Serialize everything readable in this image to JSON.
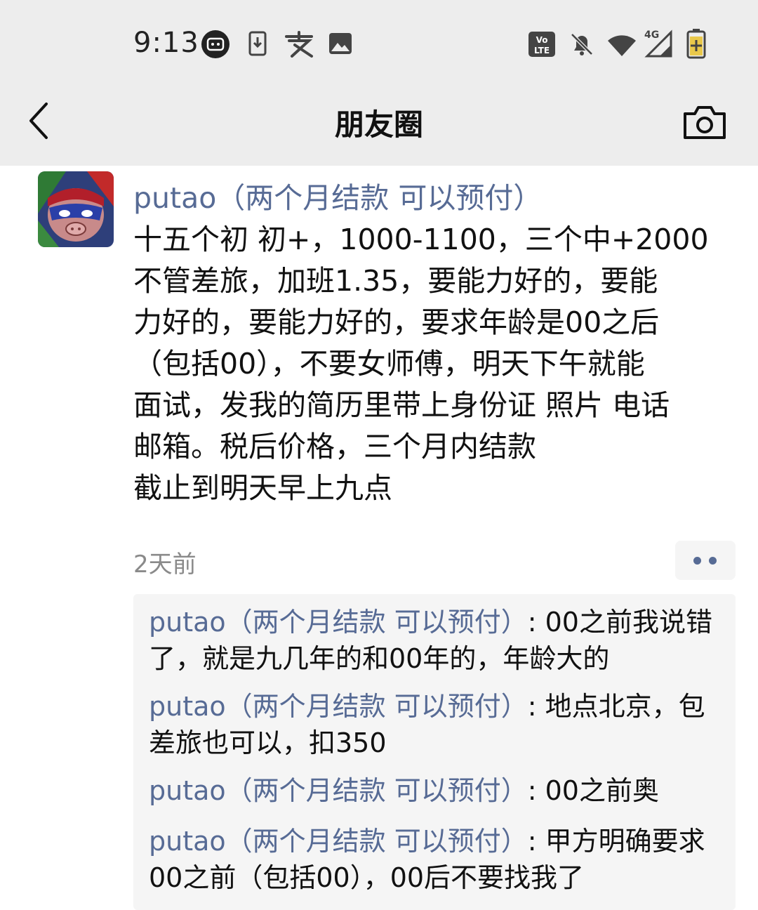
{
  "status_bar": {
    "time": "9:13",
    "left_icons": [
      "app-notification-icon",
      "download-icon",
      "alipay-icon",
      "image-icon"
    ],
    "right_icons": [
      "volte-icon",
      "mute-icon",
      "wifi-icon",
      "signal-4g-icon",
      "battery-icon"
    ],
    "volte_text": "Vo LTE",
    "network_label": "4G"
  },
  "nav": {
    "title": "朋友圈",
    "back_icon": "back-chevron-icon",
    "camera_icon": "camera-icon"
  },
  "post": {
    "author": "putao（两个月结款 可以预付）",
    "text_lines": [
      "十五个初 初+，1000-1100，三个中+2000",
      "不管差旅，加班1.35，要能力好的，要能",
      "力好的，要能力好的，要求年龄是00之后",
      "（包括00），不要女师傅，明天下午就能",
      "面试，发我的简历里带上身份证 照片 电话",
      "邮箱。税后价格，三个月内结款",
      "截止到明天早上九点"
    ],
    "time_ago": "2天前",
    "more_icon": "more-dots-icon"
  },
  "comments": [
    {
      "name": "putao（两个月结款 可以预付）",
      "text": ": 00之前我说错了，就是九几年的和00年的，年龄大的"
    },
    {
      "name": "putao（两个月结款 可以预付）",
      "text": ": 地点北京，包差旅也可以，扣350"
    },
    {
      "name": "putao（两个月结款 可以预付）",
      "text": ": 00之前奥"
    },
    {
      "name": "putao（两个月结款 可以预付）",
      "text": ": 甲方明确要求00之前（包括00），00后不要找我了"
    }
  ],
  "colors": {
    "link": "#576b95",
    "bar_bg": "#ededed",
    "comment_bg": "#f5f5f5",
    "meta": "#8a8a8a"
  }
}
